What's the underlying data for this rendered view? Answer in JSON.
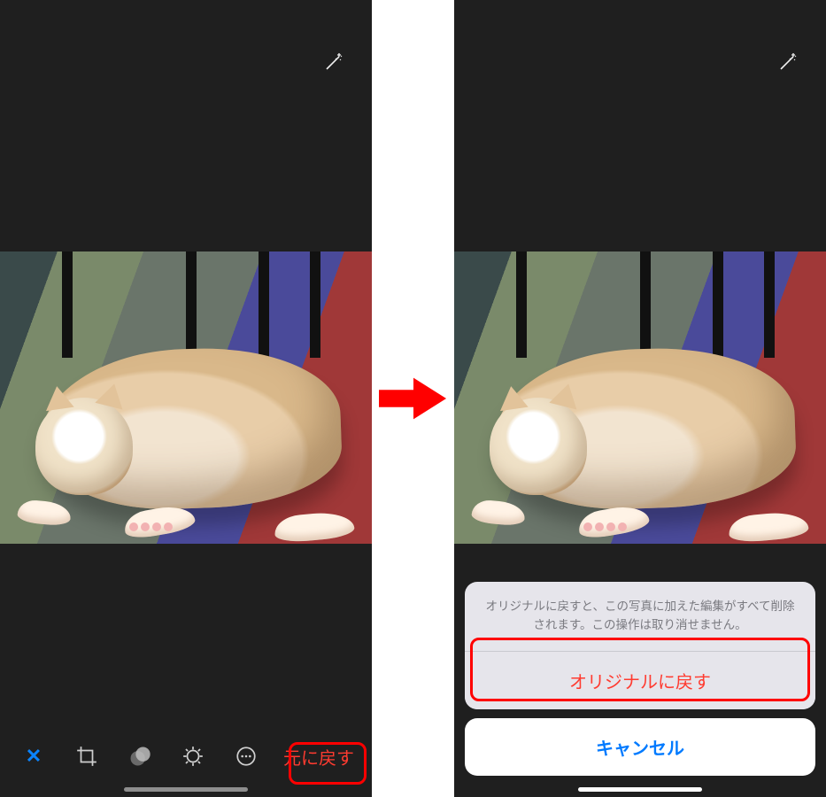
{
  "left": {
    "toolbar": {
      "cancel_symbol": "✕",
      "revert_label": "元に戻す"
    }
  },
  "right": {
    "sheet": {
      "message": "オリジナルに戻すと、この写真に加えた編集がすべて削除されます。この操作は取り消せません。",
      "revert_label": "オリジナルに戻す",
      "cancel_label": "キャンセル"
    }
  },
  "icons": {
    "wand": "magic-wand-icon",
    "crop": "crop-icon",
    "filters": "filters-icon",
    "adjust": "adjust-icon",
    "more": "more-icon"
  }
}
